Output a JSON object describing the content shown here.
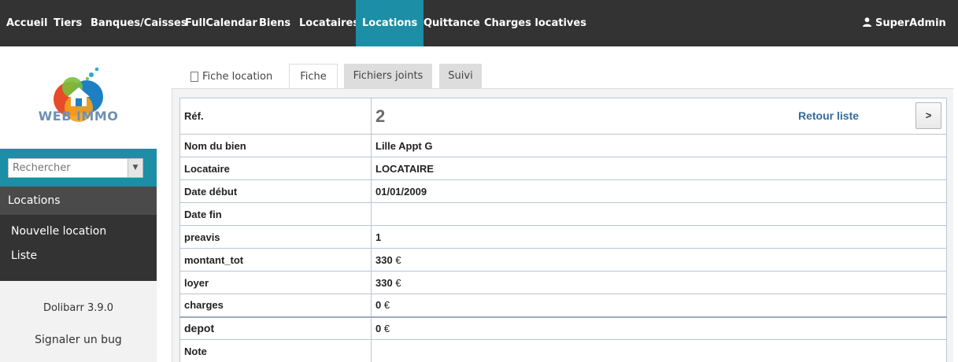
{
  "nav": {
    "items": [
      "Accueil",
      "Tiers",
      "Banques/Caisses",
      "FullCalendar",
      "Biens",
      "Locataires",
      "Locations",
      "Quittance",
      "Charges locatives"
    ],
    "active": "Locations",
    "user": "SuperAdmin"
  },
  "sidebar": {
    "logo_text": "WEB IMMO",
    "search_placeholder": "Rechercher",
    "section_title": "Locations",
    "links": [
      "Nouvelle location",
      "Liste"
    ],
    "version": "Dolibarr 3.9.0",
    "bug_link": "Signaler un bug"
  },
  "tabs": {
    "title": "Fiche location",
    "items": [
      "Fiche",
      "Fichiers joints",
      "Suivi"
    ],
    "active": "Fiche"
  },
  "record": {
    "ref_label": "Réf.",
    "ref_value": "2",
    "back_link": "Retour liste",
    "next_button": ">",
    "currency": "€",
    "fields": [
      {
        "label": "Nom du bien",
        "value": "Lille Appt G"
      },
      {
        "label": "Locataire",
        "value": "LOCATAIRE"
      },
      {
        "label": "Date début",
        "value": "01/01/2009"
      },
      {
        "label": "Date fin",
        "value": ""
      },
      {
        "label": "preavis",
        "value": "1"
      },
      {
        "label": "montant_tot",
        "value": "330"
      },
      {
        "label": "loyer",
        "value": "330"
      },
      {
        "label": "charges",
        "value": "0"
      },
      {
        "label": "depot",
        "value": "0"
      },
      {
        "label": "Note",
        "value": ""
      }
    ]
  },
  "colors": {
    "topbar": "#333333",
    "accent": "#1c8ea6",
    "link": "#2f6c9e"
  }
}
